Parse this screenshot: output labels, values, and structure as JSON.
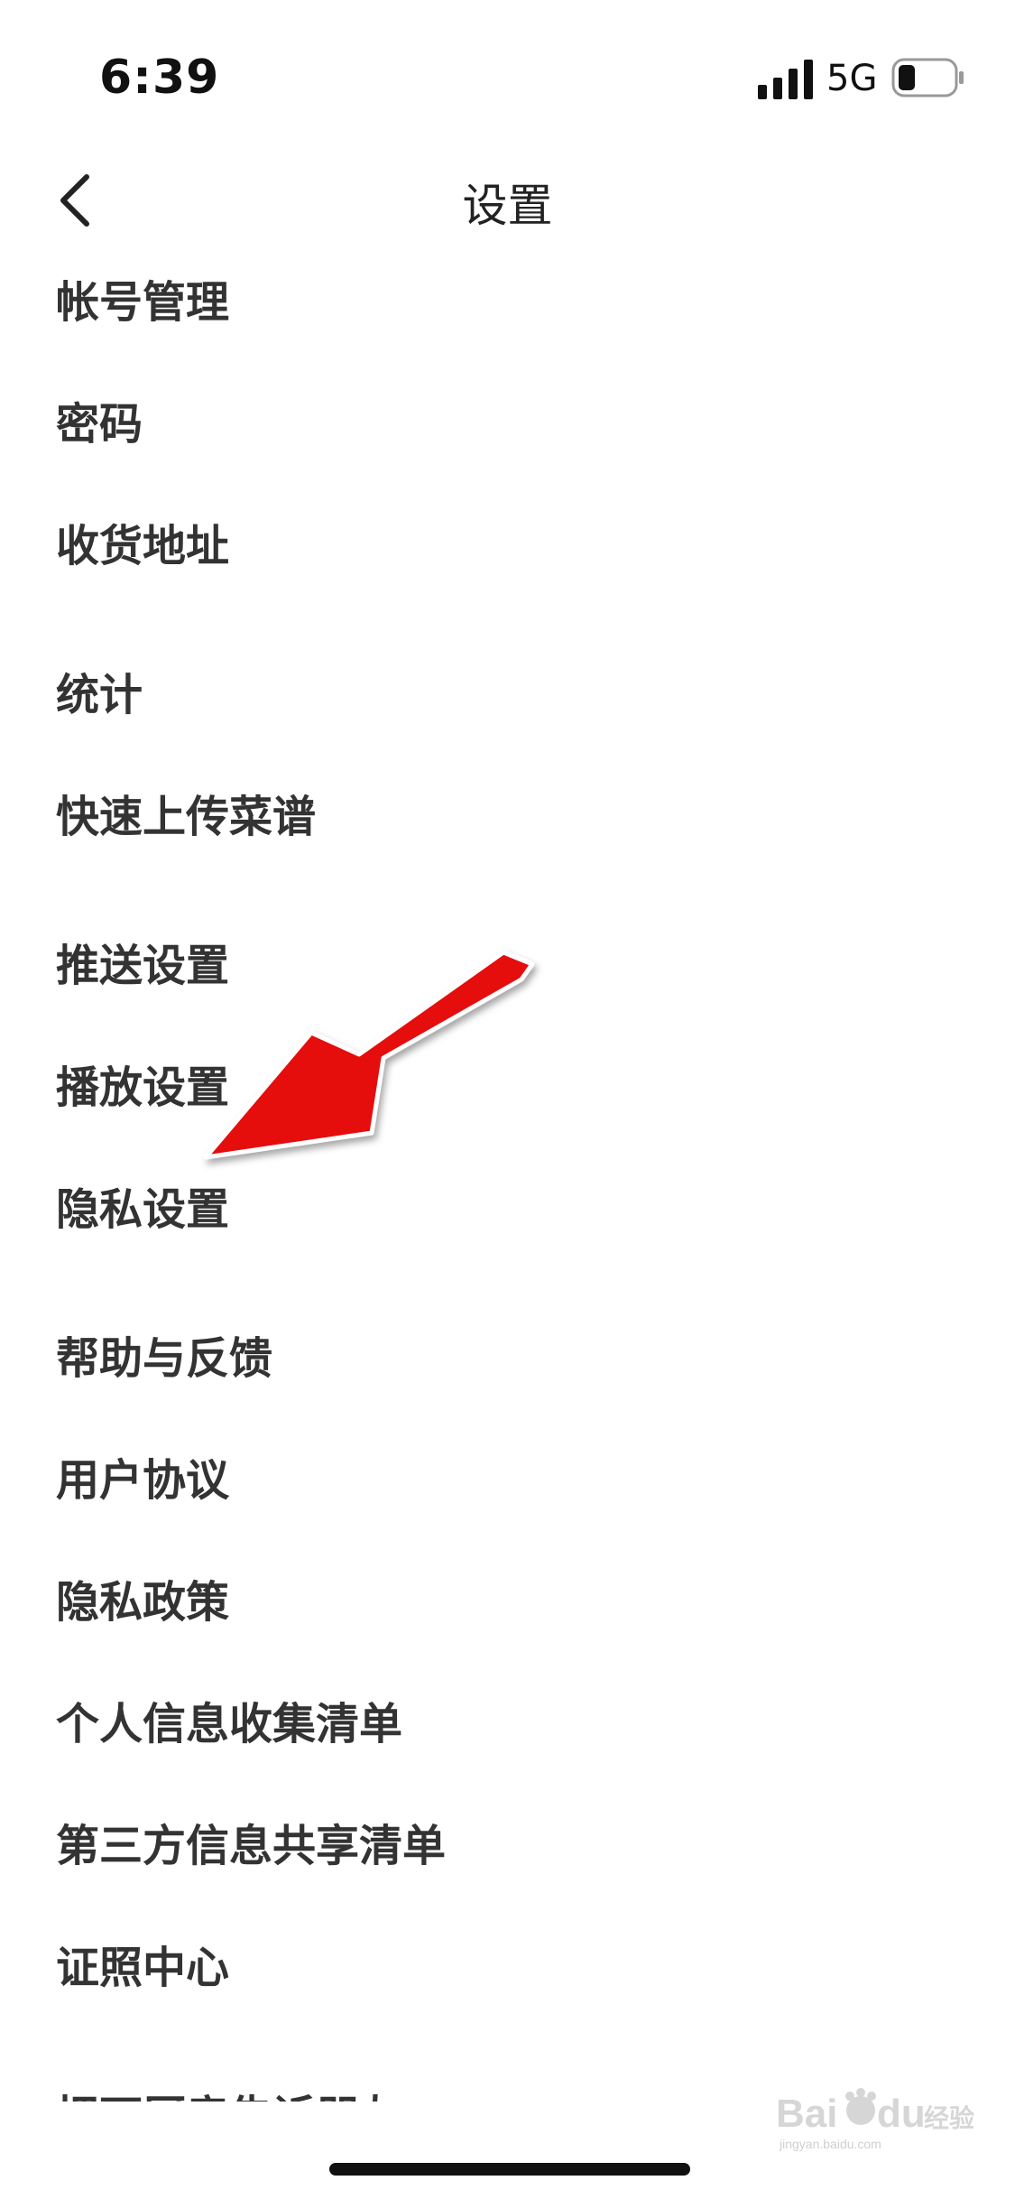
{
  "status_bar": {
    "time": "6:39",
    "network": "5G",
    "signal_icon": "cellular-signal-icon",
    "battery_icon": "battery-low-icon"
  },
  "nav_bar": {
    "back_icon": "chevron-left-icon",
    "title": "设置"
  },
  "settings": {
    "items": [
      {
        "label": "帐号管理"
      },
      {
        "label": "密码"
      },
      {
        "label": "收货地址"
      },
      {
        "label": "统计"
      },
      {
        "label": "快速上传菜谱"
      },
      {
        "label": "推送设置"
      },
      {
        "label": "播放设置"
      },
      {
        "label": "隐私设置"
      },
      {
        "label": "帮助与反馈"
      },
      {
        "label": "用户协议"
      },
      {
        "label": "隐私政策"
      },
      {
        "label": "个人信息收集清单"
      },
      {
        "label": "第三方信息共享清单"
      },
      {
        "label": "证照中心"
      },
      {
        "label": "把下厨房告诉朋友"
      }
    ]
  },
  "annotation": {
    "type": "red-arrow",
    "color": "#ee1111",
    "points_to": "隐私设置"
  },
  "watermark": {
    "text": "Baidu经验",
    "subtext": "jingyan.baidu.com"
  }
}
